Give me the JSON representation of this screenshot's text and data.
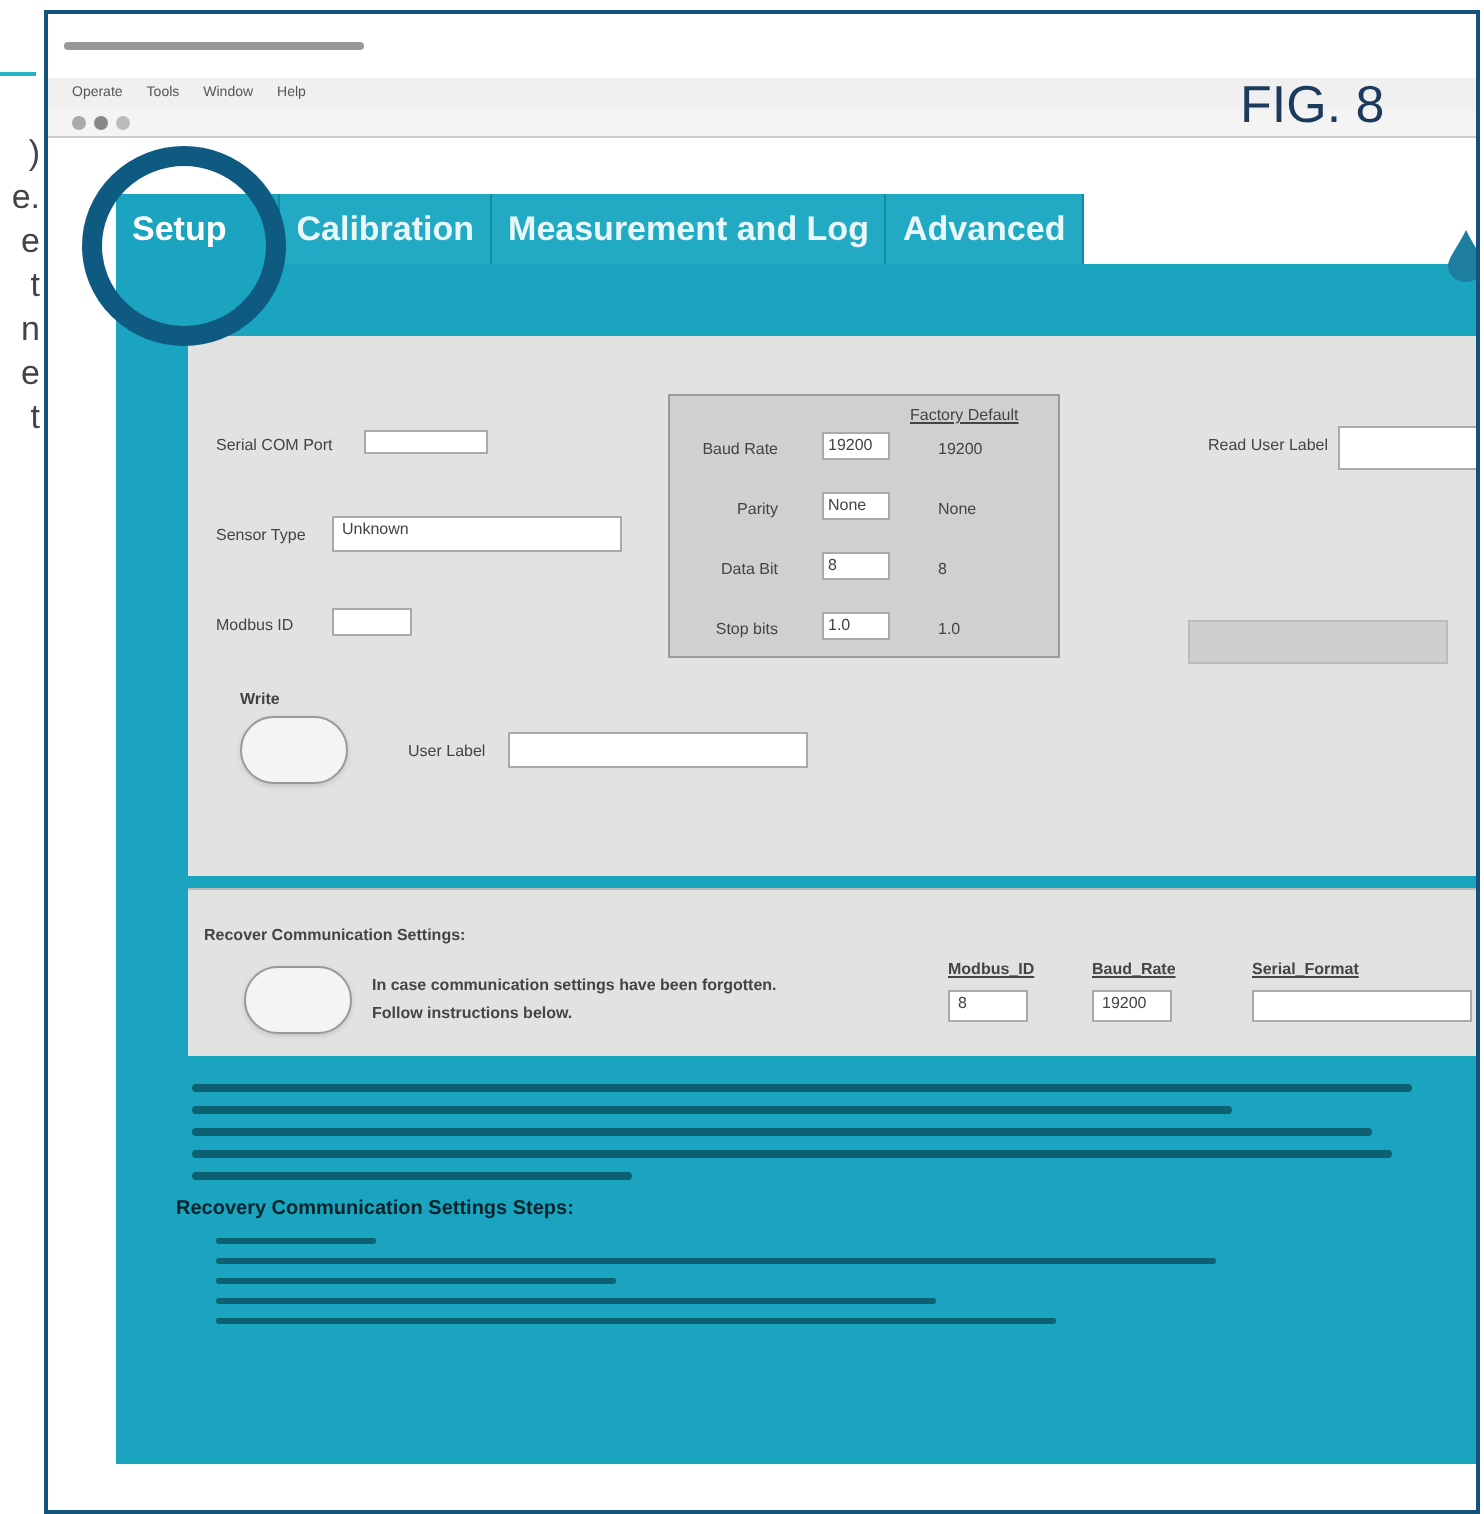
{
  "document_margin": [
    ")",
    "e.",
    "e",
    "t",
    "n",
    "e",
    "t"
  ],
  "figure_label": "FIG. 8",
  "menu": [
    "Operate",
    "Tools",
    "Window",
    "Help"
  ],
  "tabs": [
    {
      "label": "Setup",
      "selected": true
    },
    {
      "label": "Calibration",
      "selected": false
    },
    {
      "label": "Measurement and Log",
      "selected": false
    },
    {
      "label": "Advanced",
      "selected": false
    }
  ],
  "setup": {
    "serial_port_label": "Serial COM Port",
    "sensor_type_label": "Sensor Type",
    "sensor_type_value": "Unknown",
    "modbus_id_label": "Modbus ID",
    "factory_default_label": "Factory Default",
    "settings": [
      {
        "label": "Baud Rate",
        "value": "19200",
        "default": "19200"
      },
      {
        "label": "Parity",
        "value": "None",
        "default": "None"
      },
      {
        "label": "Data Bit",
        "value": "8",
        "default": "8"
      },
      {
        "label": "Stop bits",
        "value": "1.0",
        "default": "1.0"
      }
    ],
    "read_user_label": "Read User Label",
    "write_label": "Write",
    "user_label": "User Label"
  },
  "recover": {
    "title": "Recover Communication Settings:",
    "message": "In case communication settings have been forgotten.",
    "message_2": "Follow instructions below.",
    "columns": [
      {
        "label": "Modbus_ID",
        "value": "8"
      },
      {
        "label": "Baud_Rate",
        "value": "19200"
      },
      {
        "label": "Serial_Format"
      }
    ]
  },
  "steps_heading": "Recovery Communication Settings Steps:"
}
